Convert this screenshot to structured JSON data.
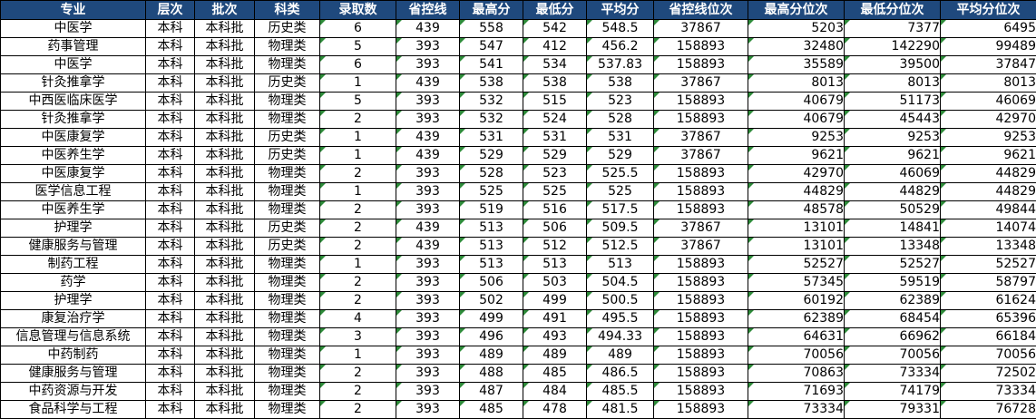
{
  "columns": [
    "专业",
    "层次",
    "批次",
    "科类",
    "录取数",
    "省控线",
    "最高分",
    "最低分",
    "平均分",
    "省控线位次",
    "最高分位次",
    "最低分位次",
    "平均分位次"
  ],
  "rows": [
    [
      "中医学",
      "本科",
      "本科批",
      "历史类",
      "6",
      "439",
      "558",
      "542",
      "548.5",
      "37867",
      "5203",
      "7377",
      "6495"
    ],
    [
      "药事管理",
      "本科",
      "本科批",
      "物理类",
      "5",
      "393",
      "547",
      "412",
      "456.2",
      "158893",
      "32480",
      "142290",
      "99489"
    ],
    [
      "中医学",
      "本科",
      "本科批",
      "物理类",
      "6",
      "393",
      "541",
      "534",
      "537.83",
      "158893",
      "35589",
      "39500",
      "37847"
    ],
    [
      "针灸推拿学",
      "本科",
      "本科批",
      "历史类",
      "1",
      "439",
      "538",
      "538",
      "538",
      "37867",
      "8013",
      "8013",
      "8013"
    ],
    [
      "中西医临床医学",
      "本科",
      "本科批",
      "物理类",
      "5",
      "393",
      "532",
      "515",
      "523",
      "158893",
      "40679",
      "51173",
      "46069"
    ],
    [
      "针灸推拿学",
      "本科",
      "本科批",
      "物理类",
      "2",
      "393",
      "532",
      "524",
      "528",
      "158893",
      "40679",
      "45443",
      "42970"
    ],
    [
      "中医康复学",
      "本科",
      "本科批",
      "历史类",
      "1",
      "439",
      "531",
      "531",
      "531",
      "37867",
      "9253",
      "9253",
      "9253"
    ],
    [
      "中医养生学",
      "本科",
      "本科批",
      "历史类",
      "1",
      "439",
      "529",
      "529",
      "529",
      "37867",
      "9621",
      "9621",
      "9621"
    ],
    [
      "中医康复学",
      "本科",
      "本科批",
      "物理类",
      "2",
      "393",
      "528",
      "523",
      "525.5",
      "158893",
      "42970",
      "46069",
      "44829"
    ],
    [
      "医学信息工程",
      "本科",
      "本科批",
      "物理类",
      "1",
      "393",
      "525",
      "525",
      "525",
      "158893",
      "44829",
      "44829",
      "44829"
    ],
    [
      "中医养生学",
      "本科",
      "本科批",
      "物理类",
      "2",
      "393",
      "519",
      "516",
      "517.5",
      "158893",
      "48578",
      "50529",
      "49844"
    ],
    [
      "护理学",
      "本科",
      "本科批",
      "历史类",
      "2",
      "439",
      "513",
      "506",
      "509.5",
      "37867",
      "13101",
      "14841",
      "14074"
    ],
    [
      "健康服务与管理",
      "本科",
      "本科批",
      "历史类",
      "2",
      "439",
      "513",
      "512",
      "512.5",
      "37867",
      "13101",
      "13348",
      "13348"
    ],
    [
      "制药工程",
      "本科",
      "本科批",
      "物理类",
      "1",
      "393",
      "513",
      "513",
      "513",
      "158893",
      "52527",
      "52527",
      "52527"
    ],
    [
      "药学",
      "本科",
      "本科批",
      "物理类",
      "2",
      "393",
      "506",
      "503",
      "504.5",
      "158893",
      "57345",
      "59519",
      "58797"
    ],
    [
      "护理学",
      "本科",
      "本科批",
      "物理类",
      "2",
      "393",
      "502",
      "499",
      "500.5",
      "158893",
      "60192",
      "62389",
      "61624"
    ],
    [
      "康复治疗学",
      "本科",
      "本科批",
      "物理类",
      "4",
      "393",
      "499",
      "491",
      "495.5",
      "158893",
      "62389",
      "68454",
      "65396"
    ],
    [
      "信息管理与信息系统",
      "本科",
      "本科批",
      "物理类",
      "3",
      "393",
      "496",
      "493",
      "494.33",
      "158893",
      "64631",
      "66962",
      "66184"
    ],
    [
      "中药制药",
      "本科",
      "本科批",
      "物理类",
      "1",
      "393",
      "489",
      "489",
      "489",
      "158893",
      "70056",
      "70056",
      "70056"
    ],
    [
      "健康服务与管理",
      "本科",
      "本科批",
      "物理类",
      "2",
      "393",
      "488",
      "485",
      "486.5",
      "158893",
      "70863",
      "73334",
      "72502"
    ],
    [
      "中药资源与开发",
      "本科",
      "本科批",
      "物理类",
      "2",
      "393",
      "487",
      "484",
      "485.5",
      "158893",
      "71693",
      "74179",
      "73334"
    ],
    [
      "食品科学与工程",
      "本科",
      "本科批",
      "物理类",
      "2",
      "393",
      "485",
      "478",
      "481.5",
      "158893",
      "73334",
      "79331",
      "76728"
    ]
  ]
}
